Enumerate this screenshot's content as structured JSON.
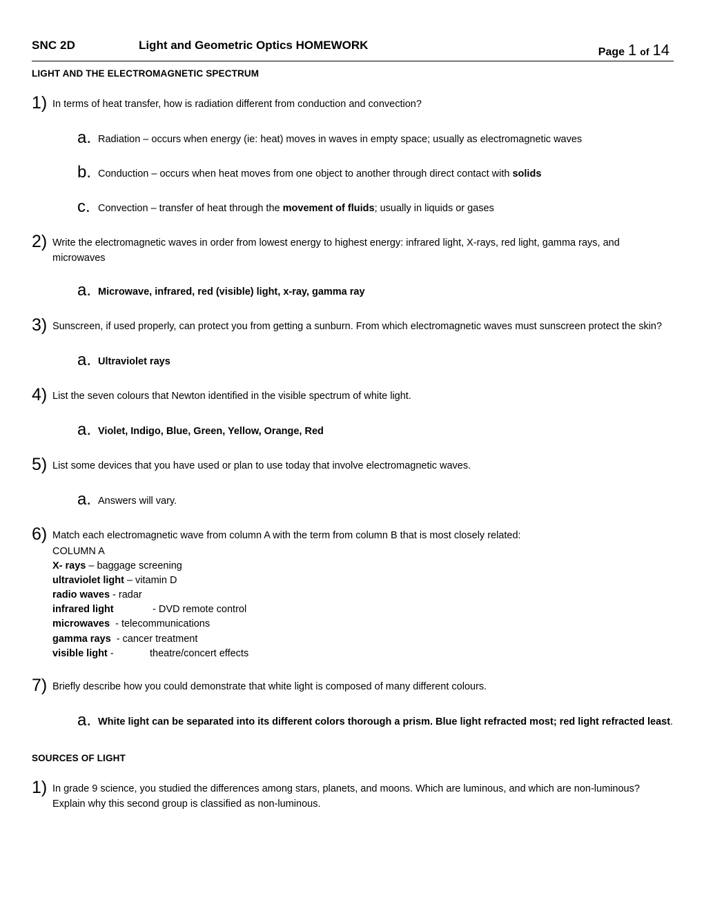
{
  "header": {
    "course": "SNC 2D",
    "title": "Light and Geometric Optics HOMEWORK",
    "page_word": "Page",
    "page_number": "1",
    "page_of": "of",
    "page_total": "14"
  },
  "sections": {
    "spectrum_heading": "LIGHT AND THE ELECTROMAGNETIC SPECTRUM",
    "sources_heading": "SOURCES OF LIGHT"
  },
  "questions": {
    "q1": {
      "marker": "1)",
      "text": "In terms of heat transfer, how is radiation different from conduction and convection?",
      "answers": [
        {
          "marker": "a.",
          "pre": "Radiation – occurs when energy (ie: heat) moves in waves in empty space; usually as electromagnetic waves",
          "bold": "",
          "post": ""
        },
        {
          "marker": "b.",
          "pre": "Conduction – occurs  when heat moves from one object to another through direct contact with ",
          "bold": "solids",
          "post": ""
        },
        {
          "marker": "c.",
          "pre": "Convection – transfer of heat through the ",
          "bold": "movement of fluids",
          "post": "; usually in liquids or gases"
        }
      ]
    },
    "q2": {
      "marker": "2)",
      "text": "Write the electromagnetic waves in order from lowest energy to highest energy: infrared light, X-rays, red light, gamma rays, and microwaves",
      "answers": [
        {
          "marker": "a.",
          "text": "Microwave, infrared, red (visible) light, x-ray, gamma ray",
          "bold": true
        }
      ]
    },
    "q3": {
      "marker": "3)",
      "text": "Sunscreen, if used properly, can protect you from getting a sunburn. From which electromagnetic waves must sunscreen protect the skin?",
      "answers": [
        {
          "marker": "a.",
          "text": "Ultraviolet rays",
          "bold": true
        }
      ]
    },
    "q4": {
      "marker": "4)",
      "text": "List the seven colours that Newton identified in the visible spectrum of white light.",
      "answers": [
        {
          "marker": "a.",
          "text": "Violet, Indigo, Blue, Green, Yellow, Orange, Red",
          "bold": true
        }
      ]
    },
    "q5": {
      "marker": "5)",
      "text": "List some devices that you have used or plan to use today that involve electromagnetic waves.",
      "answers": [
        {
          "marker": "a.",
          "text": "Answers will vary.",
          "bold": false
        }
      ]
    },
    "q6": {
      "marker": "6)",
      "text": "Match each electromagnetic wave from column A with the term from column B that is most closely related:",
      "column_title": "COLUMN A",
      "column_rows": [
        {
          "term": "X- rays",
          "desc": " – baggage screening"
        },
        {
          "term": "ultraviolet light",
          "desc": " – vitamin D"
        },
        {
          "term": "radio waves",
          "desc": " - radar"
        },
        {
          "term": "infrared light",
          "desc": "              - DVD remote control"
        },
        {
          "term": "microwaves",
          "desc": "  - telecommunications"
        },
        {
          "term": "gamma rays",
          "desc": "  - cancer treatment"
        },
        {
          "term": "visible light",
          "desc": " -             theatre/concert effects"
        }
      ]
    },
    "q7": {
      "marker": "7)",
      "text": "Briefly describe how you could demonstrate that white light is composed of many different colours.",
      "answers": [
        {
          "marker": "a.",
          "bold_text": "White light can be separated into its different colors thorough a prism. Blue light refracted most; red light refracted least",
          "tail": "."
        }
      ]
    },
    "s1q1": {
      "marker": "1)",
      "text": "In grade 9 science, you studied the differences among stars, planets, and moons. Which are luminous, and which are non-luminous? Explain why this second group is classified as non-luminous."
    }
  }
}
